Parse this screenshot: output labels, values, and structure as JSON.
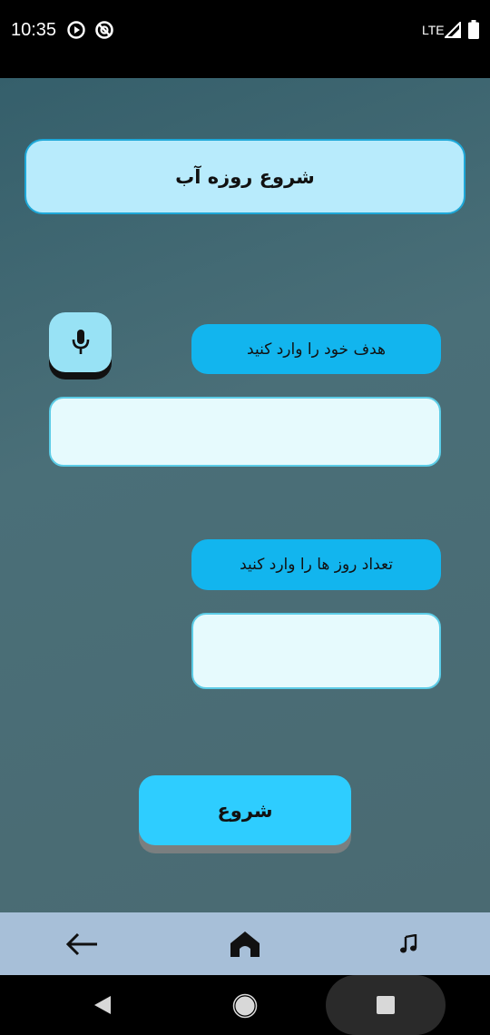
{
  "status_bar": {
    "time": "10:35",
    "network": "LTE"
  },
  "header": {
    "title": "شروع روزه آب"
  },
  "goal": {
    "label": "هدف خود را وارد کنید",
    "value": ""
  },
  "days": {
    "label": "تعداد روز ها را وارد کنید",
    "value": ""
  },
  "actions": {
    "start_label": "شروع"
  },
  "bottom_nav": {
    "items": [
      {
        "icon": "back-arrow-icon"
      },
      {
        "icon": "home-icon"
      },
      {
        "icon": "music-note-icon"
      }
    ]
  },
  "colors": {
    "title_bg": "#b8ebfc",
    "label_bg": "#12b5ee",
    "start_bg": "#2ecdff",
    "mic_bg": "#98e2f5",
    "nav_bg": "#a7bfd8"
  }
}
